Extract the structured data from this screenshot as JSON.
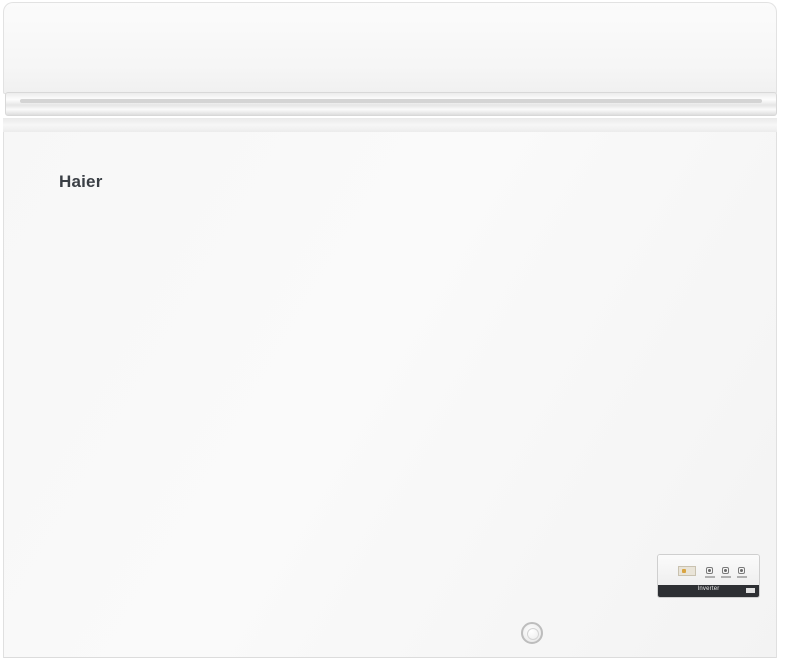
{
  "product": {
    "brand": "Haier",
    "panel_label": "Inverter"
  },
  "colors": {
    "cabinet": "#f7f7f7",
    "logo": "#3a3f45",
    "panel_bar": "#2d2f33"
  },
  "icons": [
    "display-icon",
    "button-icon",
    "drain-plug-icon"
  ]
}
